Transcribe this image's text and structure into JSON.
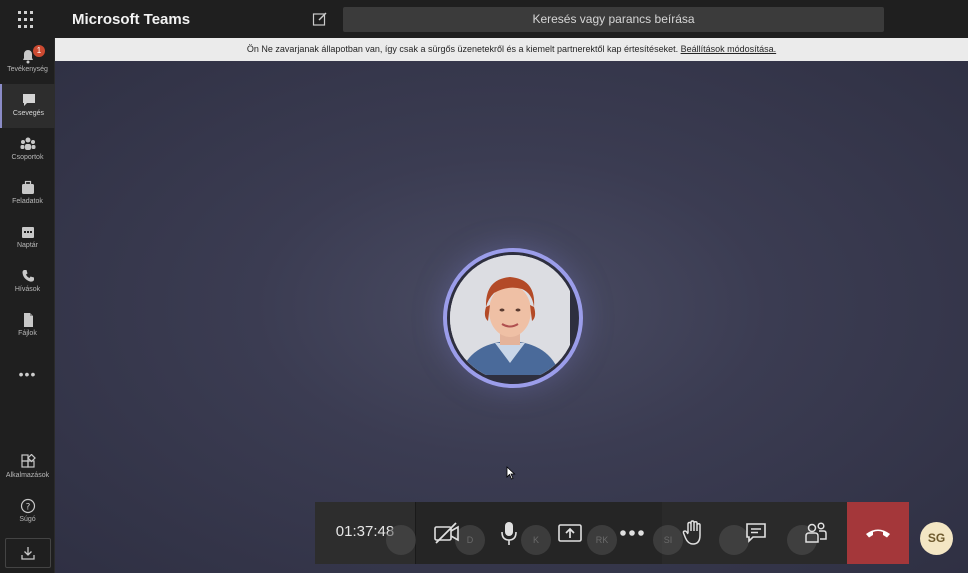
{
  "app": {
    "title": "Microsoft Teams"
  },
  "search": {
    "placeholder": "Keresés vagy parancs beírása"
  },
  "rail": {
    "items": [
      {
        "label": "Tevékenység",
        "icon": "bell-icon",
        "badge": "1"
      },
      {
        "label": "Csevegés",
        "icon": "chat-icon",
        "active": true
      },
      {
        "label": "Csoportok",
        "icon": "teams-icon"
      },
      {
        "label": "Feladatok",
        "icon": "briefcase-icon"
      },
      {
        "label": "Naptár",
        "icon": "calendar-icon"
      },
      {
        "label": "Hívások",
        "icon": "phone-icon"
      },
      {
        "label": "Fájlok",
        "icon": "file-icon"
      }
    ],
    "more": "•••",
    "bottom": [
      {
        "label": "Alkalmazások",
        "icon": "apps-icon"
      },
      {
        "label": "Súgó",
        "icon": "help-icon"
      }
    ]
  },
  "banner": {
    "text": "Ön Ne zavarjanak állapotban van, így csak a sürgős üzenetekről és a kiemelt partnerektől kap értesítéseket.",
    "link": "Beállítások módosítása."
  },
  "call": {
    "timer": "01:37:48",
    "ghost_participants": [
      "D",
      "K",
      "RK",
      "SI"
    ],
    "hangup_color": "#a4373a"
  },
  "me": {
    "initials": "SG"
  },
  "colors": {
    "accent": "#9b9dea",
    "stage": "#3b3c52"
  }
}
